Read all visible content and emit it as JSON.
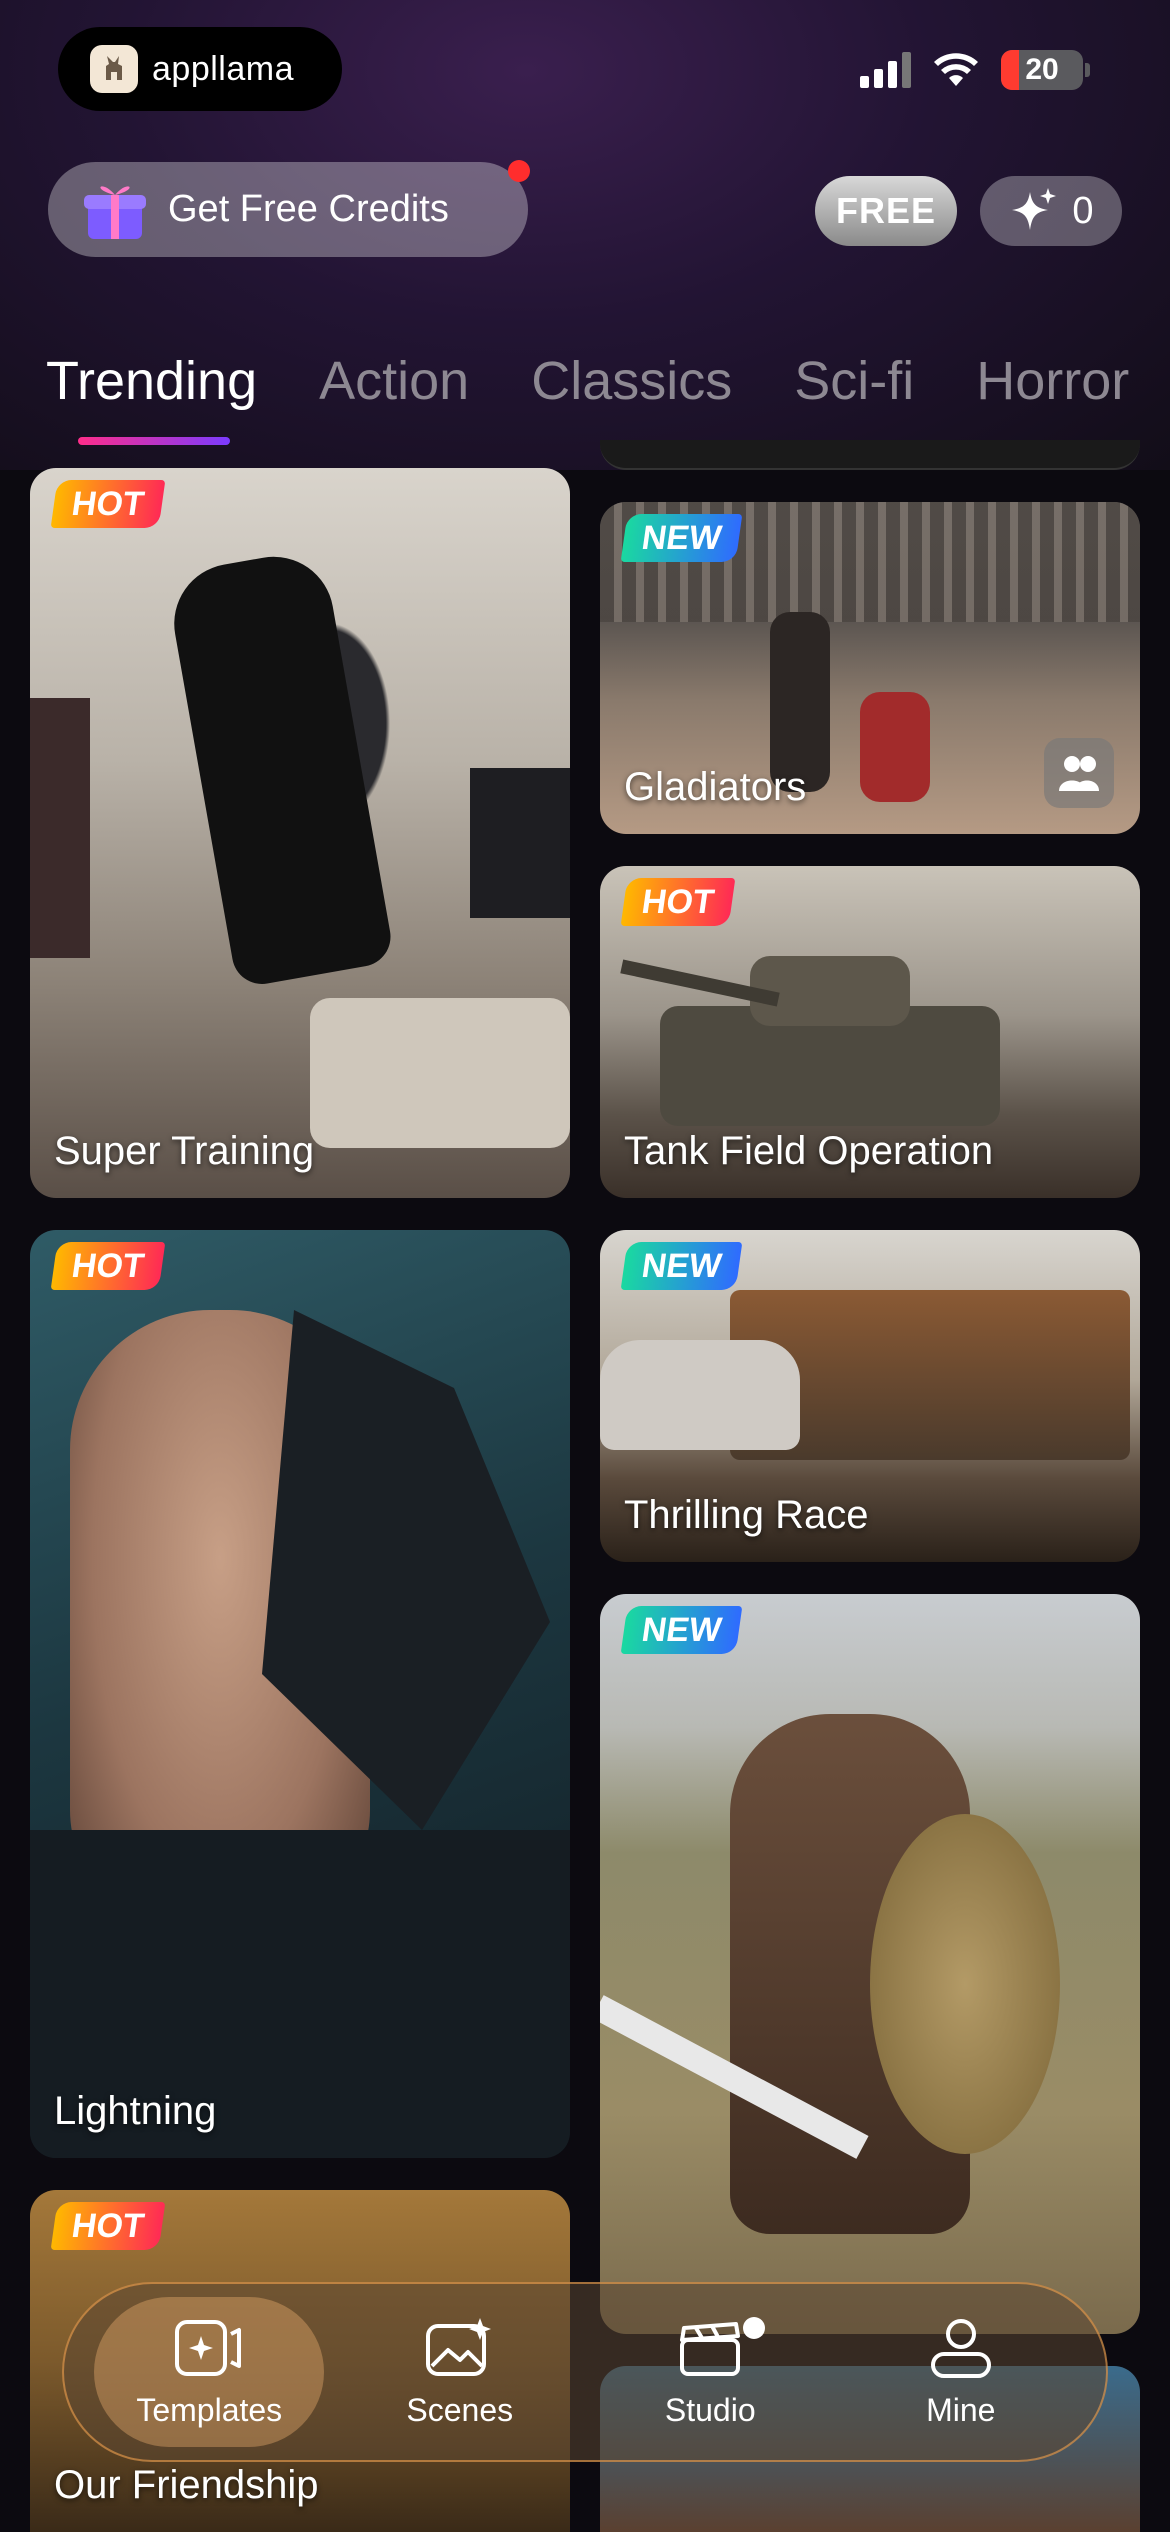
{
  "status_bar": {
    "app_pill_label": "appllama",
    "battery": "20"
  },
  "header": {
    "credits_button": "Get Free Credits",
    "free_label": "FREE",
    "credits_count": "0"
  },
  "tabs": [
    {
      "label": "Trending",
      "active": true
    },
    {
      "label": "Action",
      "active": false
    },
    {
      "label": "Classics",
      "active": false
    },
    {
      "label": "Sci-fi",
      "active": false
    },
    {
      "label": "Horror",
      "active": false
    }
  ],
  "cards": [
    {
      "title": "Super Training",
      "badge": "HOT"
    },
    {
      "title": "Gladiators",
      "badge": "NEW"
    },
    {
      "title": "Tank Field Operation",
      "badge": "HOT"
    },
    {
      "title": "Lightning",
      "badge": "HOT"
    },
    {
      "title": "Thrilling Race",
      "badge": "NEW"
    },
    {
      "title": "",
      "badge": "NEW"
    },
    {
      "title": "Our Friendship",
      "badge": "HOT"
    }
  ],
  "bottom_nav": [
    {
      "label": "Templates",
      "icon": "templates-icon",
      "active": true
    },
    {
      "label": "Scenes",
      "icon": "scenes-icon",
      "active": false
    },
    {
      "label": "Studio",
      "icon": "clapperboard-icon",
      "active": false
    },
    {
      "label": "Mine",
      "icon": "person-icon",
      "active": false
    }
  ],
  "colors": {
    "tab_accent_start": "#ff2d8a",
    "tab_accent_end": "#7b3bff",
    "hot_badge": "#ff2a55",
    "new_badge": "#2f6bff"
  }
}
